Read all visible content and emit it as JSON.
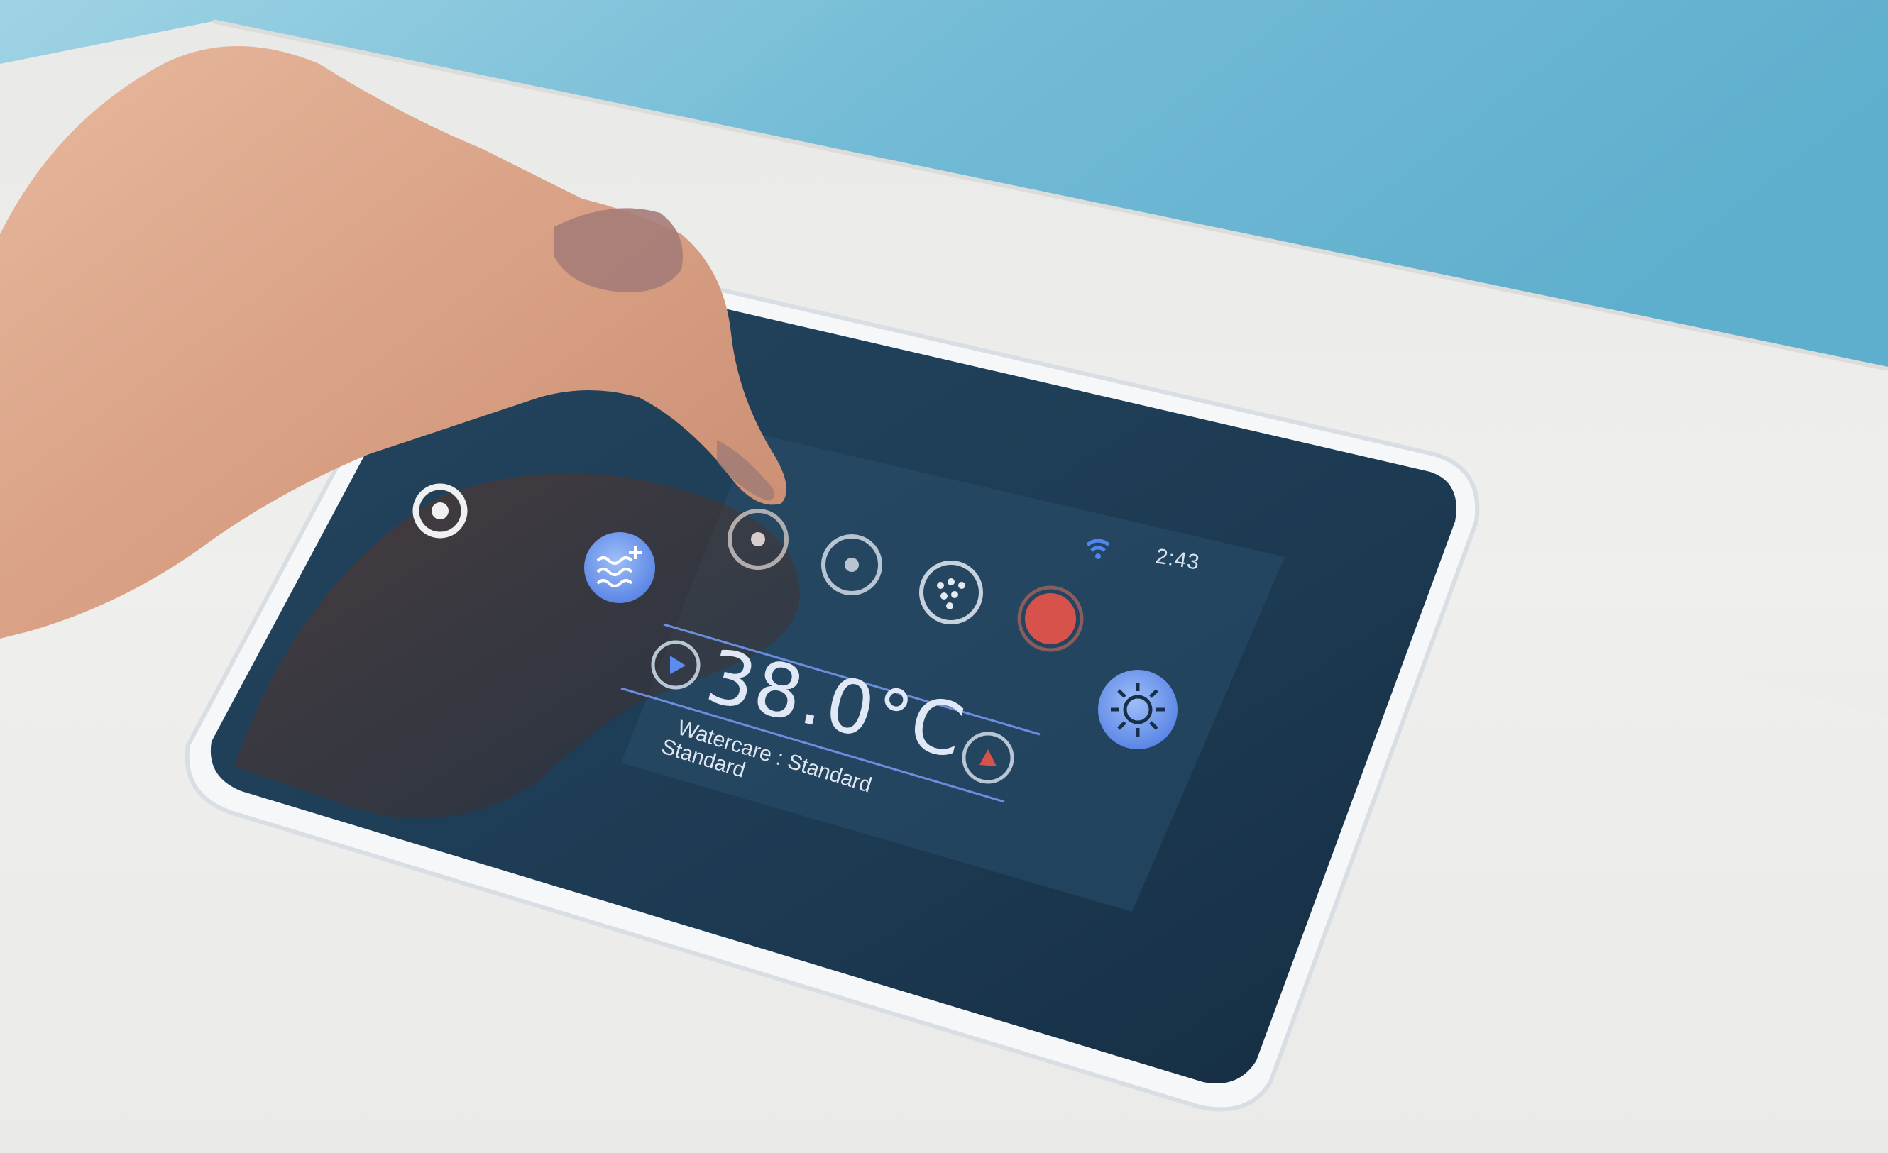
{
  "scene": {
    "description_colors": {
      "pool_water": "#7fc0d8",
      "spa_edge": "#ecebe8",
      "bezel_white": "#f2f4f5",
      "screen_dark": "#1d3950",
      "accent_blue": "#5b8cf0",
      "button_red": "#d8524c",
      "light_button": "#86aef4"
    }
  },
  "status_bar": {
    "time": "2:43",
    "wifi_icon": "wifi-icon"
  },
  "main_display": {
    "temperature": "38.0°C",
    "watercare_text": "Watercare : Standard",
    "watercare_reflection": "Standard"
  },
  "controls": {
    "power_icon": "power-ring-icon",
    "watercare_plus_icon": "water-waves-plus-icon",
    "pump1_icon": "pump-jet-icon",
    "pump2_icon": "pump-jet-icon",
    "blower_icon": "blower-bubbles-icon",
    "stop_icon": "stop-red-button-icon",
    "light_icon": "light-sun-icon",
    "temp_up_icon": "temperature-up-icon",
    "temp_down_icon": "temperature-down-icon"
  }
}
